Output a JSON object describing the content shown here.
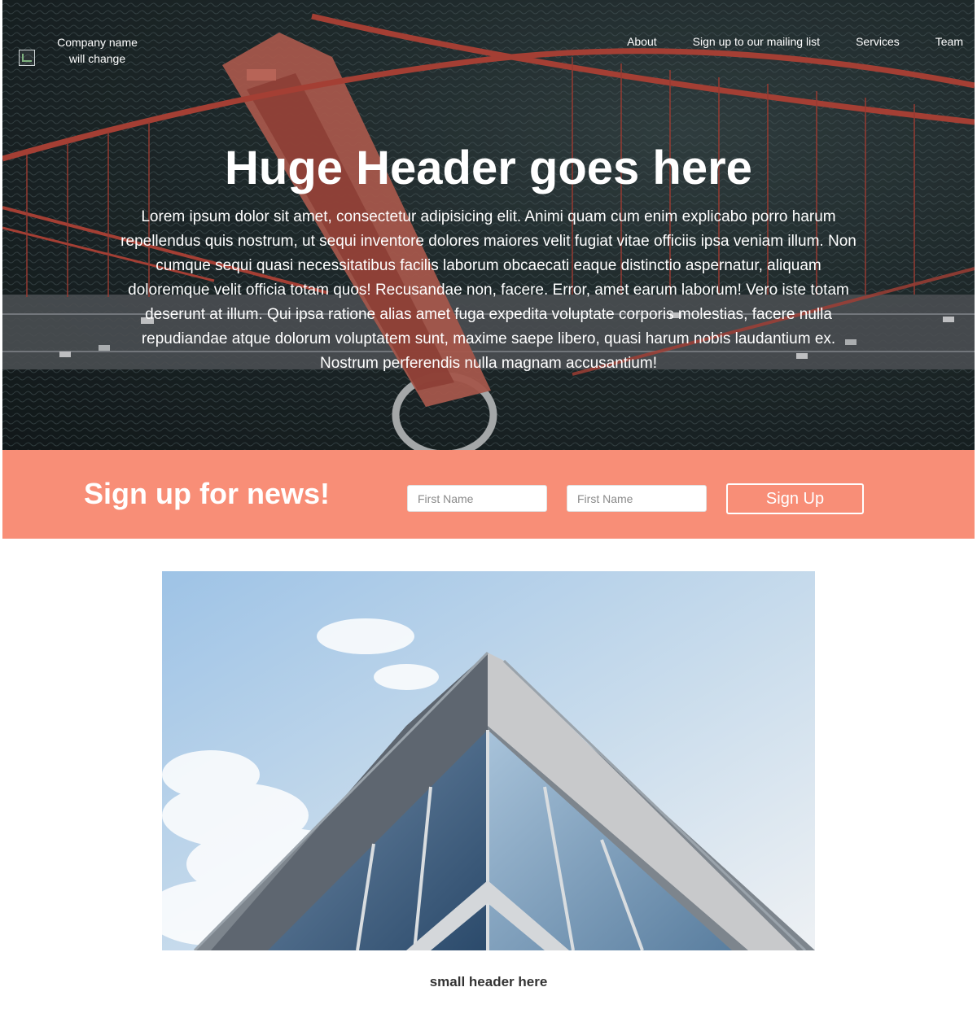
{
  "nav": {
    "company_name": "Company name will change",
    "links": [
      "About",
      "Sign up to our mailing list",
      "Services",
      "Team"
    ]
  },
  "hero": {
    "title": "Huge Header goes here",
    "body": "Lorem ipsum dolor sit amet, consectetur adipisicing elit. Animi quam cum enim explicabo porro harum repellendus quis nostrum, ut sequi inventore dolores maiores velit fugiat vitae officiis ipsa veniam illum. Non cumque sequi quasi necessitatibus facilis laborum obcaecati eaque distinctio aspernatur, aliquam doloremque velit officia totam quos! Recusandae non, facere. Error, amet earum laborum! Vero iste totam deserunt at illum. Qui ipsa ratione alias amet fuga expedita voluptate corporis molestias, facere nulla repudiandae atque dolorum voluptatem sunt, maxime saepe libero, quasi harum nobis laudantium ex. Nostrum perferendis nulla magnam accusantium!"
  },
  "signup": {
    "title": "Sign up for news!",
    "input1_placeholder": "First Name",
    "input2_placeholder": "First Name",
    "button_label": "Sign Up"
  },
  "content": {
    "small_header": "small header here"
  },
  "colors": {
    "signup_bar": "#f88e77",
    "bridge": "#d9503f"
  }
}
